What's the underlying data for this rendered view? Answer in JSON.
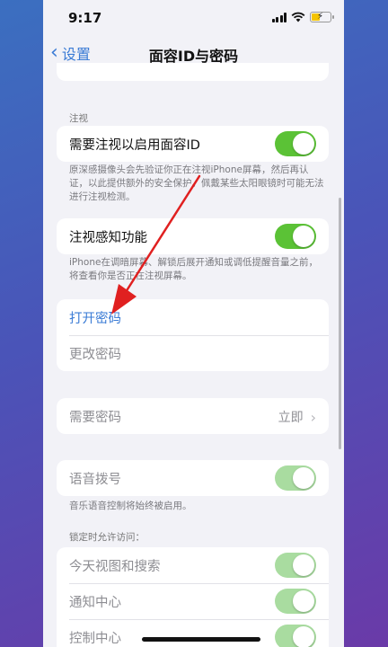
{
  "status": {
    "time": "9:17"
  },
  "nav": {
    "back_label": "设置",
    "title": "面容ID与密码"
  },
  "attention": {
    "header": "注视",
    "require_label": "需要注视以启用面容ID",
    "require_on": true,
    "require_footer": "原深感摄像头会先验证你正在注视iPhone屏幕，然后再认证，以此提供额外的安全保护。佩戴某些太阳眼镜时可能无法进行注视检测。",
    "aware_label": "注视感知功能",
    "aware_on": true,
    "aware_footer": "iPhone在调暗屏幕、解锁后展开通知或调低提醒音量之前，将查看你是否正在注视屏幕。"
  },
  "passcode": {
    "turn_on_label": "打开密码",
    "change_label": "更改密码"
  },
  "require_passcode": {
    "label": "需要密码",
    "value": "立即"
  },
  "voice_dial": {
    "label": "语音拨号",
    "on": true,
    "footer": "音乐语音控制将始终被启用。"
  },
  "locked_access": {
    "header": "锁定时允许访问：",
    "items": [
      {
        "label": "今天视图和搜索",
        "on": true
      },
      {
        "label": "通知中心",
        "on": true
      },
      {
        "label": "控制中心",
        "on": true
      }
    ]
  },
  "colors": {
    "accent": "#3a7bd5",
    "toggle_on": "#5bc236",
    "toggle_disabled": "#a9dca0",
    "annotation_arrow": "#e02020"
  }
}
